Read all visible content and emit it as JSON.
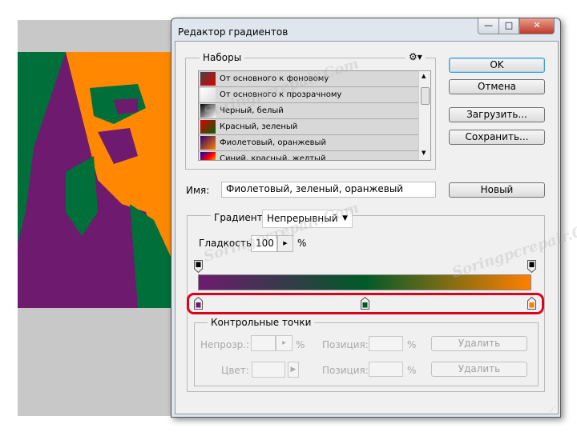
{
  "dialog": {
    "title": "Редактор градиентов",
    "minimize": "—",
    "maximize": "□",
    "close": "✕"
  },
  "presets": {
    "label": "Наборы",
    "items": [
      {
        "label": "От основного к фоновому",
        "colors": [
          "#444444",
          "#e00000"
        ]
      },
      {
        "label": "От основного к прозрачному",
        "colors": [
          "#ffffff",
          "#dddddd"
        ]
      },
      {
        "label": "Черный, белый",
        "colors": [
          "#000000",
          "#ffffff"
        ]
      },
      {
        "label": "Красный, зеленый",
        "colors": [
          "#e00000",
          "#006000"
        ]
      },
      {
        "label": "Фиолетовый, оранжевый",
        "colors": [
          "#300070",
          "#ff8000"
        ]
      },
      {
        "label": "Синий, красный, желтый",
        "colors": [
          "#0000c0",
          "#ff0000",
          "#ffff00"
        ]
      }
    ]
  },
  "buttons": {
    "ok": "OK",
    "cancel": "Отмена",
    "load": "Загрузить...",
    "save": "Сохранить...",
    "new": "Новый"
  },
  "name": {
    "label": "Имя:",
    "value": "Фиолетовый, зеленый, оранжевый"
  },
  "gradient": {
    "type_label": "Градиент:",
    "type_value": "Непрерывный",
    "smoothness_label": "Гладкость:",
    "smoothness_value": "100",
    "percent": "%",
    "opacity_stops": [
      {
        "position": 0,
        "color": "#000000"
      },
      {
        "position": 100,
        "color": "#000000"
      }
    ],
    "color_stops": [
      {
        "position": 0,
        "color": "#6e1a6e"
      },
      {
        "position": 50,
        "color": "#005a28"
      },
      {
        "position": 100,
        "color": "#ff7f00"
      }
    ]
  },
  "control_points": {
    "label": "Контрольные точки",
    "opacity_label": "Непрозр.:",
    "color_label": "Цвет:",
    "position_label": "Позиция:",
    "percent": "%",
    "delete": "Удалить"
  },
  "watermark": "Soringpcrepair.Com"
}
